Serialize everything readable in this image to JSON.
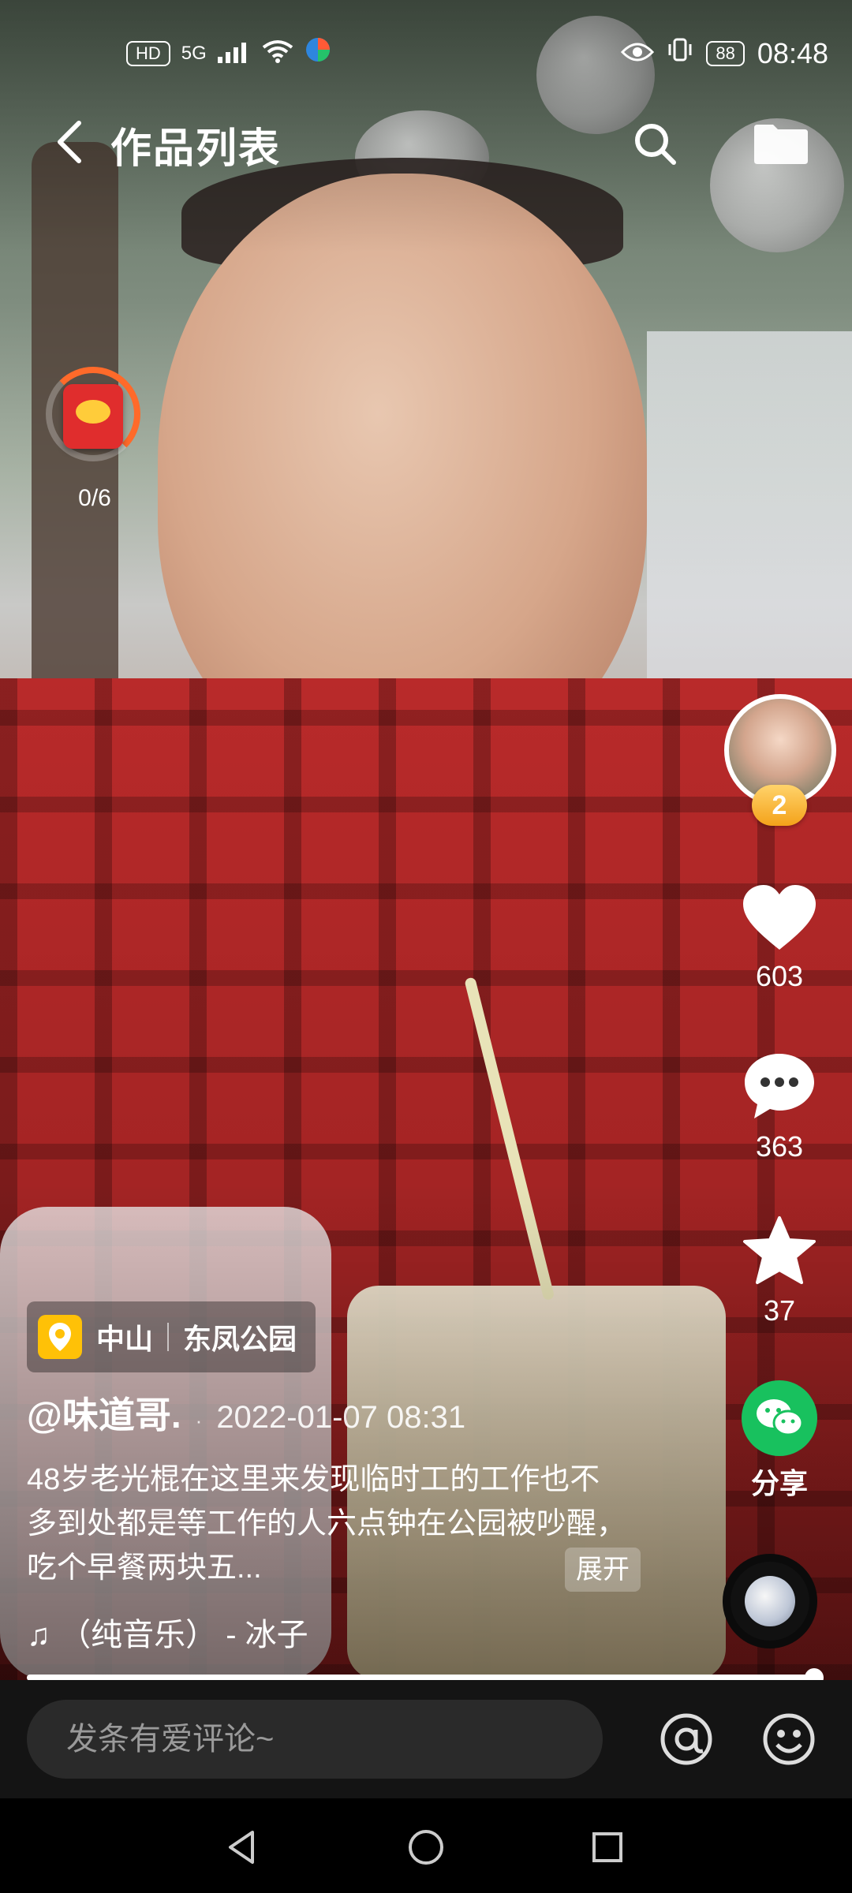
{
  "status_bar": {
    "hd": "HD",
    "network": "5G",
    "battery": "88",
    "time": "08:48"
  },
  "header": {
    "title": "作品列表"
  },
  "red_packet": {
    "count": "0/6"
  },
  "right_rail": {
    "avatar_badge": "2",
    "likes": "603",
    "comments": "363",
    "favorites": "37",
    "share_label": "分享"
  },
  "location": {
    "city": "中山",
    "place": "东凤公园"
  },
  "post": {
    "author": "@味道哥.",
    "datetime": "2022-01-07 08:31",
    "description": "48岁老光棍在这里来发现临时工的工作也不多到处都是等工作的人六点钟在公园被吵醒，吃个早餐两块五...",
    "expand_label": "展开",
    "music": "♫ （纯音乐） - 冰子"
  },
  "progress": {
    "value": 1.0
  },
  "comment_bar": {
    "placeholder": "发条有爱评论~"
  },
  "colors": {
    "share_green": "#18c15e",
    "location_yellow": "#ffc107",
    "badge_gold": "#f4a21a",
    "packet_red": "#e02d2d"
  }
}
